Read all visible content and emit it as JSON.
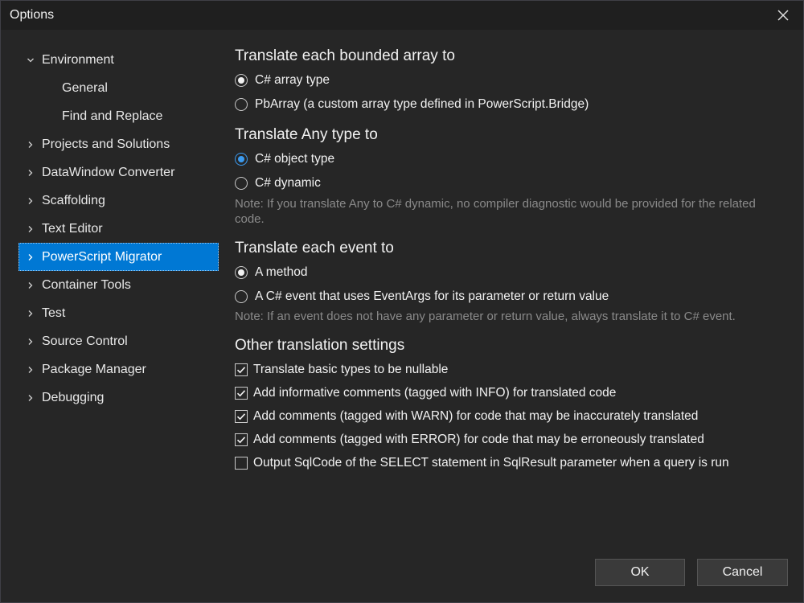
{
  "window": {
    "title": "Options"
  },
  "tree": [
    {
      "label": "Environment",
      "expanded": true,
      "icon": "chevron-down-icon"
    },
    {
      "label": "General",
      "child": true
    },
    {
      "label": "Find and Replace",
      "child": true
    },
    {
      "label": "Projects and Solutions",
      "icon": "chevron-right-icon"
    },
    {
      "label": "DataWindow Converter",
      "icon": "chevron-right-icon"
    },
    {
      "label": "Scaffolding",
      "icon": "chevron-right-icon"
    },
    {
      "label": "Text Editor",
      "icon": "chevron-right-icon"
    },
    {
      "label": "PowerScript Migrator",
      "selected": true,
      "icon": "chevron-right-icon"
    },
    {
      "label": "Container Tools",
      "icon": "chevron-right-icon"
    },
    {
      "label": "Test",
      "icon": "chevron-right-icon"
    },
    {
      "label": "Source Control",
      "icon": "chevron-right-icon"
    },
    {
      "label": "Package Manager",
      "icon": "chevron-right-icon"
    },
    {
      "label": "Debugging",
      "icon": "chevron-right-icon"
    }
  ],
  "sections": {
    "bounded_array": {
      "title": "Translate each bounded array to",
      "options": [
        "C# array type",
        "PbArray (a custom array type defined in PowerScript.Bridge)"
      ],
      "selected_index": 0
    },
    "any_type": {
      "title": "Translate Any type to",
      "options": [
        "C# object type",
        "C# dynamic"
      ],
      "selected_index": 0,
      "note": "Note: If you translate Any to C# dynamic, no compiler diagnostic would be provided for the related code."
    },
    "event": {
      "title": "Translate each event to",
      "options": [
        "A method",
        "A C# event that uses EventArgs for its parameter or return value"
      ],
      "selected_index": 0,
      "note": "Note: If an event does not have any parameter or return value, always translate it to C# event."
    },
    "other": {
      "title": "Other translation settings",
      "checks": [
        {
          "label": "Translate basic types to be nullable",
          "checked": true
        },
        {
          "label": "Add informative comments (tagged with INFO) for translated code",
          "checked": true
        },
        {
          "label": "Add comments (tagged with WARN) for code that may be inaccurately translated",
          "checked": true
        },
        {
          "label": "Add comments (tagged with ERROR) for code that may be erroneously translated",
          "checked": true
        },
        {
          "label": "Output SqlCode of the SELECT statement in SqlResult parameter when a query is run",
          "checked": false
        }
      ]
    }
  },
  "buttons": {
    "ok": "OK",
    "cancel": "Cancel"
  },
  "colors": {
    "accent": "#0078d4",
    "radio_accent": "#3c9bf0",
    "background": "#262626",
    "note": "#8a8a8a"
  }
}
